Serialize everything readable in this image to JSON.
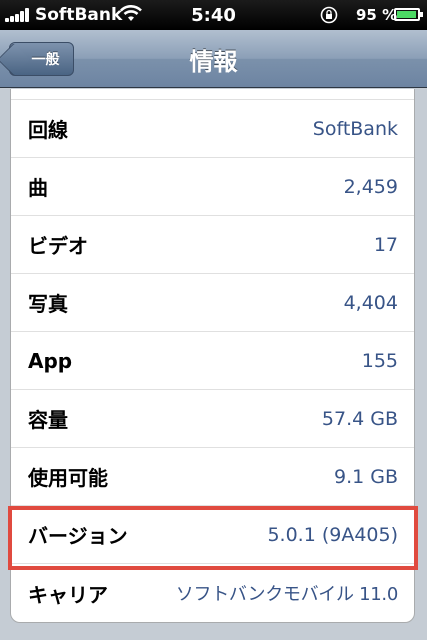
{
  "status_bar": {
    "carrier": "SoftBank",
    "time": "5:40",
    "battery_percent": "95 %",
    "battery_level": 0.95
  },
  "nav": {
    "back_label": "一般",
    "title": "情報"
  },
  "rows": [
    {
      "label": "回線",
      "value": "SoftBank"
    },
    {
      "label": "曲",
      "value": "2,459"
    },
    {
      "label": "ビデオ",
      "value": "17"
    },
    {
      "label": "写真",
      "value": "4,404"
    },
    {
      "label": "App",
      "value": "155"
    },
    {
      "label": "容量",
      "value": "57.4 GB"
    },
    {
      "label": "使用可能",
      "value": "9.1 GB"
    },
    {
      "label": "バージョン",
      "value": "5.0.1 (9A405)"
    },
    {
      "label": "キャリア",
      "value": "ソフトバンクモバイル 11.0"
    }
  ],
  "colors": {
    "value_text": "#385487",
    "highlight_border": "#e04a3f"
  }
}
